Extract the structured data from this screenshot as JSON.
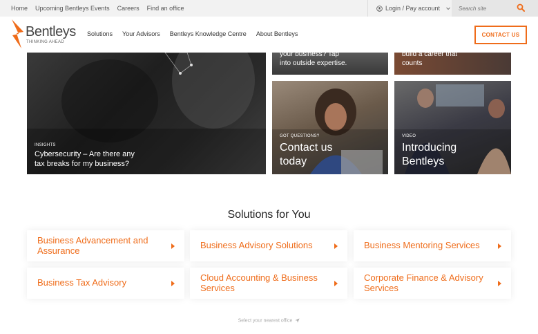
{
  "topbar": {
    "links": [
      "Home",
      "Upcoming Bentleys Events",
      "Careers",
      "Find an office"
    ],
    "login_label": "Login / Pay account",
    "search_placeholder": "Search site"
  },
  "header": {
    "brand_name": "Bentleys",
    "brand_tagline": "THINKING AHEAD",
    "nav": [
      "Solutions",
      "Your Advisors",
      "Bentleys Knowledge Centre",
      "About Bentleys"
    ],
    "contact_button": "CONTACT US"
  },
  "tiles": {
    "big": {
      "label": "INSIGHTS",
      "title_line1": "Cybersecurity – Are there any",
      "title_line2": "tax breaks for my business?"
    },
    "top1": {
      "line1": "your business? Tap",
      "line2": "into outside expertise."
    },
    "top2": {
      "line1": "build a career that",
      "line2": "counts"
    },
    "contact": {
      "label": "GOT QUESTIONS?",
      "title_line1": "Contact us",
      "title_line2": "today"
    },
    "video": {
      "label": "VIDEO",
      "title_line1": "Introducing",
      "title_line2": "Bentleys"
    }
  },
  "solutions": {
    "title": "Solutions for You",
    "cards": [
      "Business Advancement and Assurance",
      "Business Advisory Solutions",
      "Business Mentoring Services",
      "Business Tax Advisory",
      "Cloud Accounting & Business Services",
      "Corporate Finance & Advisory Services"
    ]
  },
  "footer": {
    "nearest_office": "Select your nearest office"
  },
  "colors": {
    "accent": "#ef6c1a"
  }
}
